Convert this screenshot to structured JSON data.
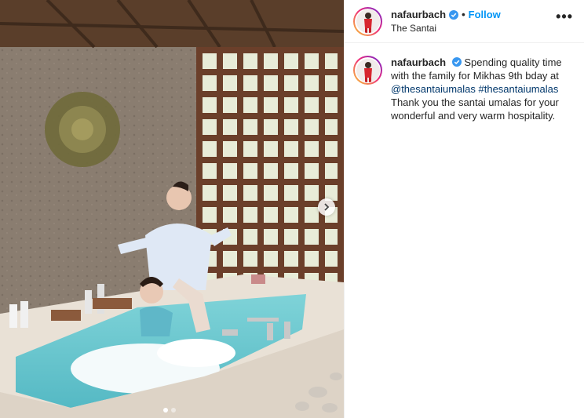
{
  "post": {
    "username": "nafaurbach",
    "location": "The Santai",
    "follow_label": "Follow",
    "separator": "•",
    "more_label": "•••",
    "caption": {
      "username": "nafaurbach",
      "line1": "Spending quality time with the family for Mikhas 9th bday at",
      "mention": "@thesantaiumalas",
      "hashtag": "#thesantaiumalas",
      "line2": "Thank you the santai umalas for your wonderful and very warm hospitality."
    },
    "carousel": {
      "slide_count": 2,
      "active_slide": 1
    }
  },
  "colors": {
    "accent": "#0095f6",
    "link": "#00376b",
    "verified": "#3897f0"
  },
  "icons": [
    "verified-badge-icon",
    "more-options-icon",
    "chevron-right-icon"
  ]
}
